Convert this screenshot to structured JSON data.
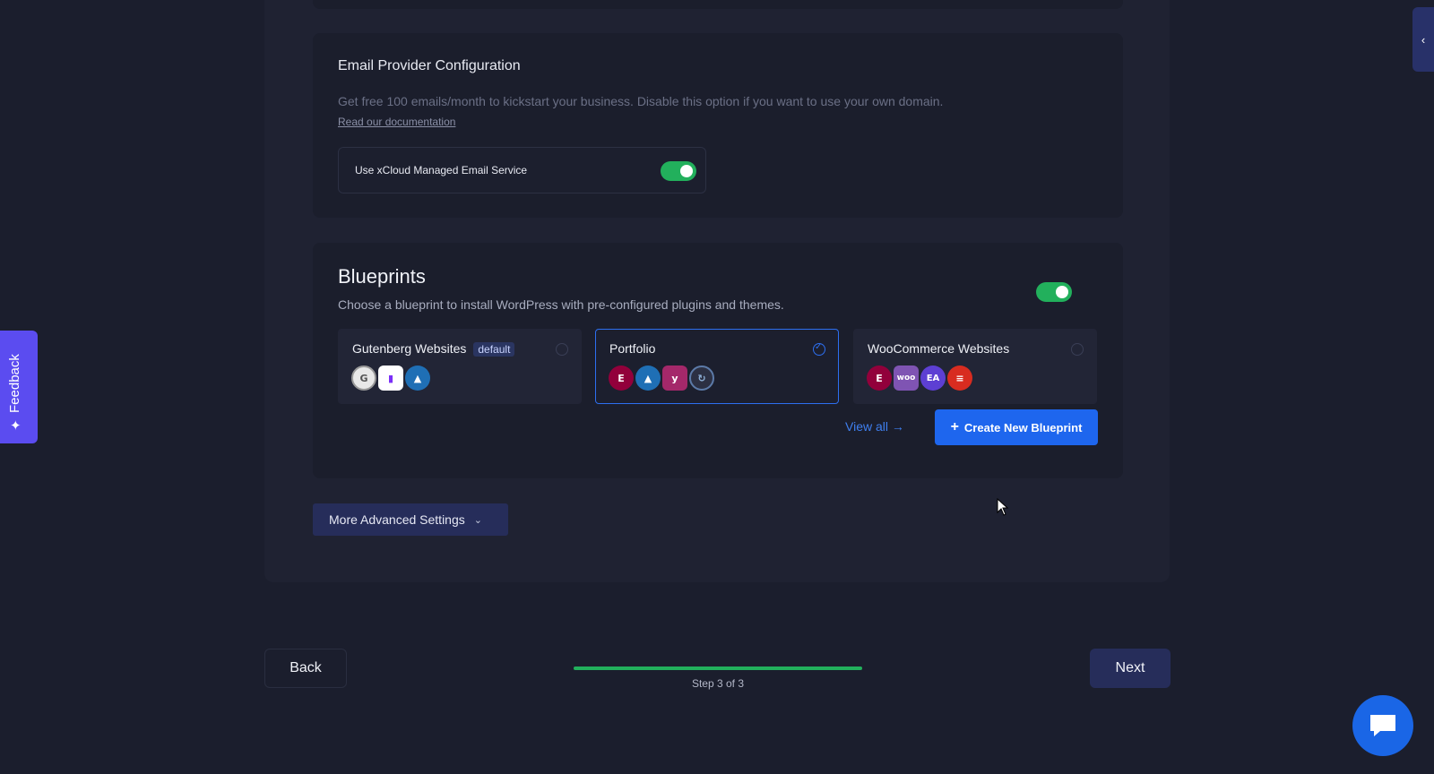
{
  "email": {
    "title": "Email Provider Configuration",
    "description": "Get free 100 emails/month to kickstart your business. Disable this option if you want to use your own domain.",
    "doc_link": "Read our documentation",
    "option_label": "Use xCloud Managed Email Service",
    "option_enabled": true
  },
  "blueprints": {
    "title": "Blueprints",
    "description": "Choose a blueprint to install WordPress with pre-configured plugins and themes.",
    "enabled": true,
    "options": [
      {
        "name": "Gutenberg Websites",
        "badge": "default",
        "selected": false,
        "icons": [
          "gutenberg-icon",
          "kadence-icon",
          "mountain-icon"
        ]
      },
      {
        "name": "Portfolio",
        "selected": true,
        "icons": [
          "elementor-icon",
          "mountain-icon",
          "yoast-icon",
          "updraft-icon"
        ]
      },
      {
        "name": "WooCommerce Websites",
        "selected": false,
        "icons": [
          "elementor-icon",
          "woo-icon",
          "ea-icon",
          "redis-icon"
        ]
      }
    ],
    "view_all": "View all",
    "create_label": "Create New Blueprint"
  },
  "advanced": {
    "label": "More Advanced Settings"
  },
  "nav": {
    "back": "Back",
    "next": "Next",
    "step_text": "Step 3 of 3",
    "progress": 1.0
  },
  "feedback": {
    "label": "Feedback"
  },
  "colors": {
    "accent": "#1e66ee",
    "success": "#22b05c",
    "feedback": "#5b4cf0",
    "background": "#1b1e2d"
  }
}
